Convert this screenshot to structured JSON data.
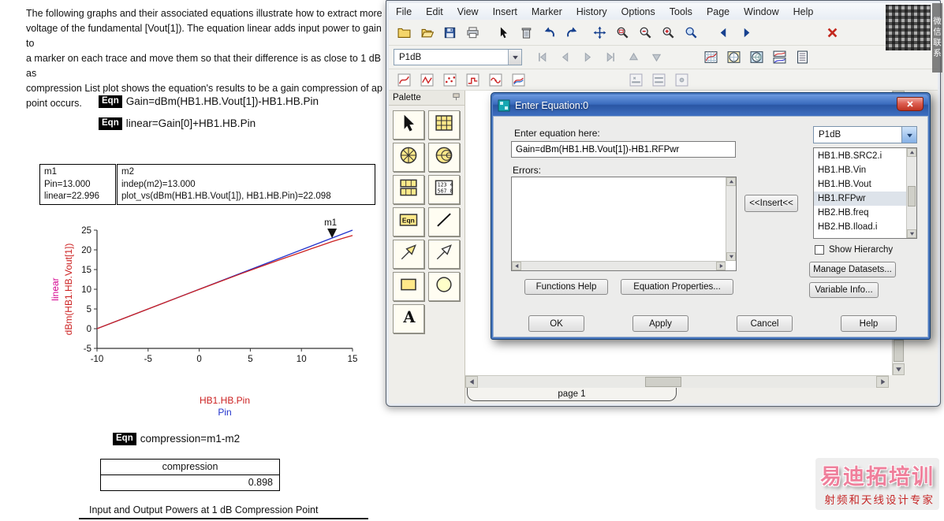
{
  "document": {
    "paragraph": [
      "The following graphs and their associated equations illustrate how to extract more",
      "voltage of the fundamental [Vout[1]). The equation linear adds input power to gain to",
      "a marker on each trace and move them so that their difference is as close to 1 dB as",
      "compression List plot shows the equation's results to be a gain compression of ap",
      "point occurs."
    ],
    "equation1": {
      "chip": "Eqn",
      "text": "Gain=dBm(HB1.HB.Vout[1])-HB1.HB.Pin"
    },
    "equation2": {
      "chip": "Eqn",
      "text": "linear=Gain[0]+HB1.HB.Pin"
    },
    "equation3": {
      "chip": "Eqn",
      "text": "compression=m1-m2"
    },
    "marker_box1": [
      "m1",
      "Pin=13.000",
      "linear=22.996"
    ],
    "marker_box2": [
      "m2",
      "indep(m2)=13.000",
      "plot_vs(dBm(HB1.HB.Vout[1]), HB1.HB.Pin)=22.098"
    ],
    "result_table": {
      "header": "compression",
      "value": "0.898"
    },
    "caption": "Input and Output Powers at 1 dB Compression Point"
  },
  "chart_data": {
    "type": "line",
    "x": [
      -10,
      -8,
      -6,
      -4,
      -2,
      0,
      2,
      4,
      6,
      8,
      10,
      11,
      12,
      13,
      14,
      15
    ],
    "series": [
      {
        "name": "linear",
        "color": "#2233cc",
        "values": [
          0,
          2,
          4,
          6,
          8,
          10,
          12,
          14,
          16,
          18,
          20,
          21,
          22,
          23,
          24,
          25
        ]
      },
      {
        "name": "dBm(HB1.HB.Vout[1])",
        "color": "#cc2222",
        "values": [
          0,
          2,
          4,
          6,
          7.99,
          9.97,
          11.93,
          13.86,
          15.75,
          17.6,
          19.4,
          20.32,
          21.2,
          22.1,
          22.9,
          23.65
        ]
      }
    ],
    "xlim": [
      -10,
      15
    ],
    "ylim": [
      -5,
      25
    ],
    "xticks": [
      -10,
      -5,
      0,
      5,
      10,
      15
    ],
    "yticks": [
      -5,
      0,
      5,
      10,
      15,
      20,
      25
    ],
    "xlabel_line1": "HB1.HB.Pin",
    "xlabel_line2": "Pin",
    "ylabel_left": "linear",
    "ylabel_right": "dBm(HB1.HB.Vout[1])",
    "xlabel_colors": [
      "#cc2222",
      "#2233cc"
    ],
    "ylabel_colors": [
      "#d4008f",
      "#cc2222"
    ],
    "axis_color": "#333",
    "tick_color": "#111",
    "grid": false,
    "legend": "none",
    "marker": {
      "label": "m1",
      "x": 13,
      "y": 23
    }
  },
  "window": {
    "menu": [
      "File",
      "Edit",
      "View",
      "Insert",
      "Marker",
      "History",
      "Options",
      "Tools",
      "Page",
      "Window",
      "Help"
    ],
    "dataset_selector": "P1dB",
    "toolbar_main": [
      "new-file",
      "open-file",
      "save-file",
      "print",
      "pointer",
      "delete",
      "undo",
      "redo",
      "move",
      "zoom-area",
      "zoom-out",
      "zoom-in",
      "zoom-select",
      "page-back",
      "page-forward",
      "close-x"
    ],
    "toolbar_marker_tools": [
      "marker-first",
      "marker-prev",
      "marker-next",
      "marker-last",
      "marker-up",
      "marker-down"
    ],
    "toolbar_insert_tools": [
      "insert-rect-plot",
      "insert-polar-plot",
      "insert-smith-plot",
      "insert-stack-plot",
      "insert-list-plot"
    ],
    "toolbar_trace_tools": [
      "trace-auto",
      "trace-linear",
      "trace-scatter",
      "trace-step",
      "trace-spline",
      "trace-dual"
    ],
    "toolbar_limit_tools": [
      "limit-line",
      "limit-band",
      "limit-point"
    ],
    "palette": {
      "title": "Palette",
      "tools": [
        "pointer",
        "rect-plot",
        "polar-plot",
        "smith-chart",
        "stack-plot",
        "list-plot",
        "equation",
        "line",
        "arrow-filled",
        "arrow-outline",
        "rectangle",
        "ellipse",
        "text"
      ],
      "equation_tool_label": "Eqn",
      "list_tool_lines": [
        "123 4",
        "567 8"
      ],
      "text_tool_label": "A"
    },
    "page_tab": "page 1"
  },
  "dialog": {
    "title": "Enter Equation:0",
    "equation_label": "Enter equation here:",
    "equation_value": "Gain=dBm(HB1.HB.Vout[1])-HB1.RFPwr",
    "errors_label": "Errors:",
    "insert_button": "<<Insert<<",
    "dataset_dropdown": "P1dB",
    "variables": [
      "HB1.HB.SRC2.i",
      "HB1.HB.Vin",
      "HB1.HB.Vout",
      "HB1.RFPwr",
      "HB2.HB.freq",
      "HB2.HB.Iload.i"
    ],
    "selected_variable_index": 3,
    "show_hierarchy_label": "Show Hierarchy",
    "manage_datasets_button": "Manage Datasets...",
    "variable_info_button": "Variable Info...",
    "functions_help_button": "Functions Help",
    "equation_properties_button": "Equation Properties...",
    "ok_button": "OK",
    "apply_button": "Apply",
    "cancel_button": "Cancel",
    "help_button": "Help"
  },
  "watermarks": {
    "qr_caption": "微信联系",
    "brand": "易迪拓培训",
    "brand_sub": "射频和天线设计专家"
  }
}
